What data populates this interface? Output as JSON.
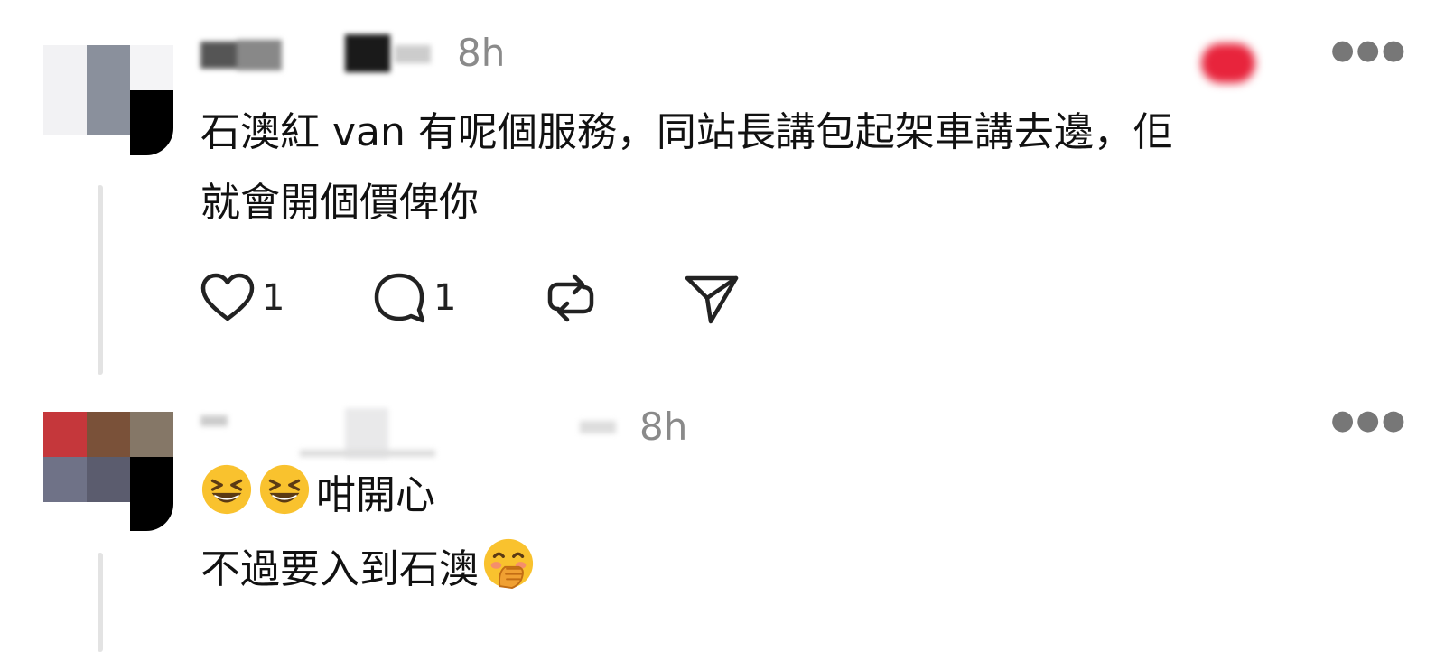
{
  "posts": [
    {
      "time": "8h",
      "text_lines": [
        "石澳紅 van 有呢個服務，同站長講包起架車講去邊，佢",
        "就會開個價俾你"
      ],
      "likes": "1",
      "replies": "1",
      "avatar_colors": [
        "#f2f2f4",
        "#8a909c",
        "#f4f4f6",
        "#ffffff",
        "#8a909c",
        "#000000"
      ],
      "badge_color": "#e8243c"
    },
    {
      "time": "8h",
      "text_line1": "咁開心",
      "text_line2": "不過要入到石澳",
      "avatar_colors": [
        "#c5373b",
        "#7a5139",
        "#857767",
        "#6f7287",
        "#5b5c6e",
        "#000000"
      ]
    }
  ],
  "icons": {
    "like": "heart-icon",
    "reply": "speech-bubble-icon",
    "repost": "repost-icon",
    "share": "paper-plane-icon",
    "more": "ellipsis-icon",
    "emoji1": "grinning-squinting-face",
    "emoji2": "face-with-hand-over-mouth"
  }
}
